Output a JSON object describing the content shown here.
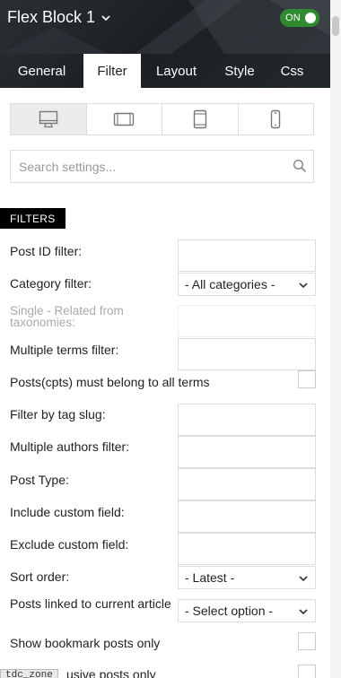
{
  "header": {
    "block_title": "Flex Block 1",
    "toggle_label": "ON",
    "toggle_color": "#2e8b30",
    "tabs": [
      {
        "label": "General"
      },
      {
        "label": "Filter"
      },
      {
        "label": "Layout"
      },
      {
        "label": "Style"
      },
      {
        "label": "Css"
      }
    ],
    "active_tab": "Filter"
  },
  "devices": [
    {
      "icon": "desktop-icon",
      "selected": true
    },
    {
      "icon": "tablet-landscape-icon",
      "selected": false
    },
    {
      "icon": "tablet-portrait-icon",
      "selected": false
    },
    {
      "icon": "phone-icon",
      "selected": false
    }
  ],
  "search": {
    "placeholder": "Search settings...",
    "value": ""
  },
  "section": {
    "title": "FILTERS"
  },
  "fields": {
    "post_id": "Post ID filter:",
    "category": "Category filter:",
    "category_value": "- All categories -",
    "single_related": "Single - Related from taxonomies:",
    "multiple_terms": "Multiple terms filter:",
    "posts_belong": "Posts(cpts) must belong to all terms",
    "tag_slug": "Filter by tag slug:",
    "multiple_authors": "Multiple authors filter:",
    "post_type": "Post Type:",
    "include_custom": "Include custom field:",
    "exclude_custom": "Exclude custom field:",
    "sort_order": "Sort order:",
    "sort_order_value": "- Latest -",
    "posts_linked": "Posts linked to current article",
    "posts_linked_value": "- Select option -",
    "show_bookmark": "Show bookmark posts only",
    "exclusive": "usive posts only"
  },
  "tooltip": {
    "text": "tdc_zone"
  }
}
